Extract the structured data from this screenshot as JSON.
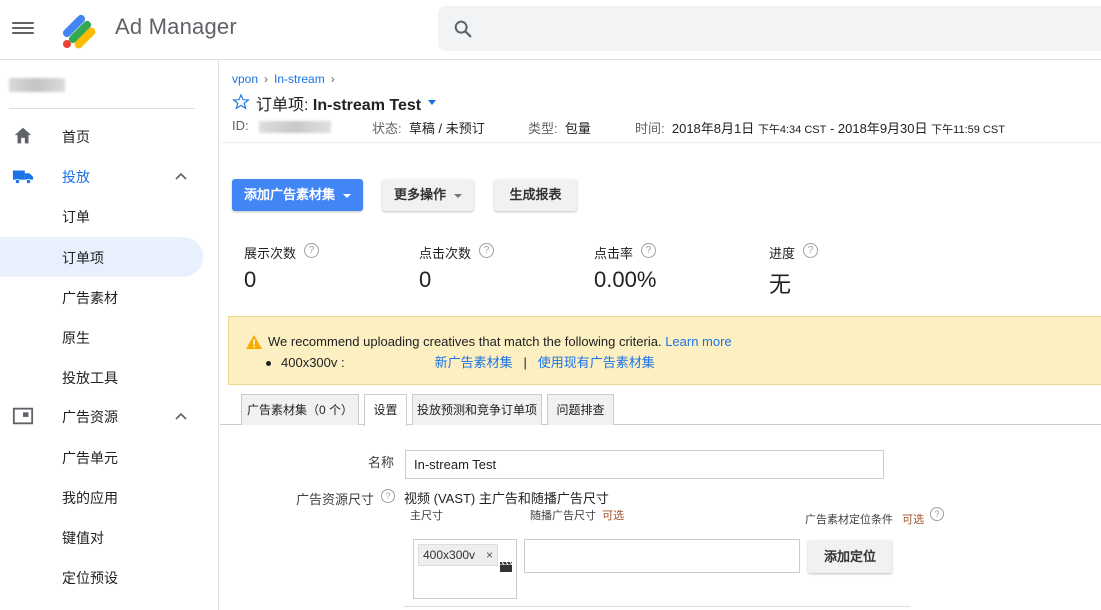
{
  "header": {
    "app_title": "Ad Manager",
    "search_placeholder": ""
  },
  "sidebar": {
    "items": [
      {
        "label": "首页",
        "icon": "home-icon"
      },
      {
        "label": "投放",
        "icon": "truck-icon"
      },
      {
        "label": "订单"
      },
      {
        "label": "订单项"
      },
      {
        "label": "广告素材"
      },
      {
        "label": "原生"
      },
      {
        "label": "投放工具"
      },
      {
        "label": "广告资源",
        "icon": "inventory-icon"
      },
      {
        "label": "广告单元"
      },
      {
        "label": "我的应用"
      },
      {
        "label": "键值对"
      },
      {
        "label": "定位预设"
      }
    ]
  },
  "breadcrumb": [
    "vpon",
    "In-stream"
  ],
  "line_item": {
    "title_prefix": "订单项: ",
    "title_name": "In-stream Test",
    "id_label": "ID:",
    "status_label": "状态:",
    "status_value": "草稿 / 未预订",
    "type_label": "类型:",
    "type_value": "包量",
    "time_label": "时间:",
    "start_date": "2018年8月1日",
    "start_time": "下午4:34 CST",
    "dash": " - ",
    "end_date": "2018年9月30日",
    "end_time": "下午11:59 CST"
  },
  "actions": {
    "add_creative_set": "添加广告素材集",
    "more_actions": "更多操作",
    "generate_report": "生成报表"
  },
  "stats": [
    {
      "label": "展示次数",
      "value": "0"
    },
    {
      "label": "点击次数",
      "value": "0"
    },
    {
      "label": "点击率",
      "value": "0.00%"
    },
    {
      "label": "进度",
      "value": "无"
    }
  ],
  "alert": {
    "message": "We recommend uploading creatives that match the following criteria.",
    "learn_more": "Learn more",
    "size": "400x300v :",
    "new_set": "新广告素材集",
    "divider": "|",
    "use_existing": "使用现有广告素材集"
  },
  "tabs": [
    "广告素材集（0 个）",
    "设置",
    "投放预测和竞争订单项",
    "问题排查"
  ],
  "form": {
    "name_label": "名称",
    "name_value": "In-stream Test",
    "inventory_size_label": "广告资源尺寸",
    "inventory_size_value": "视频 (VAST) 主广告和随播广告尺寸",
    "master_size_label": "主尺寸",
    "companion_label": "随播广告尺寸",
    "optional": "可选",
    "creative_targeting_label": "广告素材定位条件",
    "chip_value": "400x300v",
    "add_targeting": "添加定位"
  },
  "colors": {
    "accent": "#1a73e8",
    "primary_button": "#4285f4",
    "alert_bg": "#fcefc1",
    "optional_text": "#a0522d"
  }
}
